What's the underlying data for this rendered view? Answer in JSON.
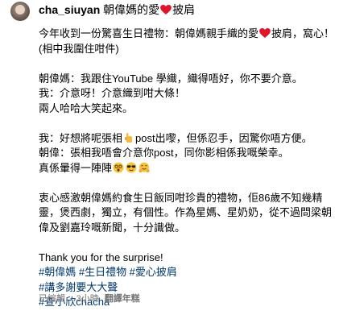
{
  "post": {
    "username": "cha_siuyan",
    "title_before": "朝偉媽的愛",
    "title_after": "披肩",
    "p1_l1_before": "今年收到一份驚喜生日禮物：朝偉媽親手織的愛",
    "p1_l1_after": "披肩，窩心！",
    "p1_l2": "(相中我圍住咁件)",
    "p2_l1": "朝偉媽：我跟住YouTube 學織，織得唔好，你不要介意。",
    "p2_l2": "我：介意呀！介意織到咁大條！",
    "p2_l3": "兩人哈哈大笑起來。",
    "p3_l1_before": "我：好想將呢張相",
    "p3_l1_after": "post出嚟，但係忍手，因驚你唔方便。",
    "p3_l2": "朝偉：張相我唔會介意你post，同你影相係我嘅榮幸。",
    "p3_l3": "真係暈得一陣陣",
    "p4_l1": "衷心感激朝偉媽約食生日飯同咁珍貴的禮物，佢86歲不知幾精",
    "p4_l2": "靈，煲西劇，獨立，有個性。作為星媽、星奶奶，從不過問梁朝",
    "p4_l3": "偉及劉嘉玲嘅新聞，十分識做。",
    "thanks": "Thank you for the surprise!",
    "hashtags_l1": "#朝偉媽 #生日禮物 #愛心披肩",
    "hashtags_l2": "#講多謝要大大聲",
    "hashtags_l3": "#查小欣chacha",
    "edited": "已編輯",
    "time": "3小時",
    "translate": "翻譯年糕",
    "colors": {
      "heart": "#e0142d",
      "hashtag": "#00376b",
      "meta": "#737373"
    },
    "icons": [
      "avatar",
      "red-heart-icon",
      "hand-emoji-icon",
      "dizzy-face-emoji-icon",
      "sunglasses-emoji-icon",
      "hug-emoji-icon"
    ]
  }
}
